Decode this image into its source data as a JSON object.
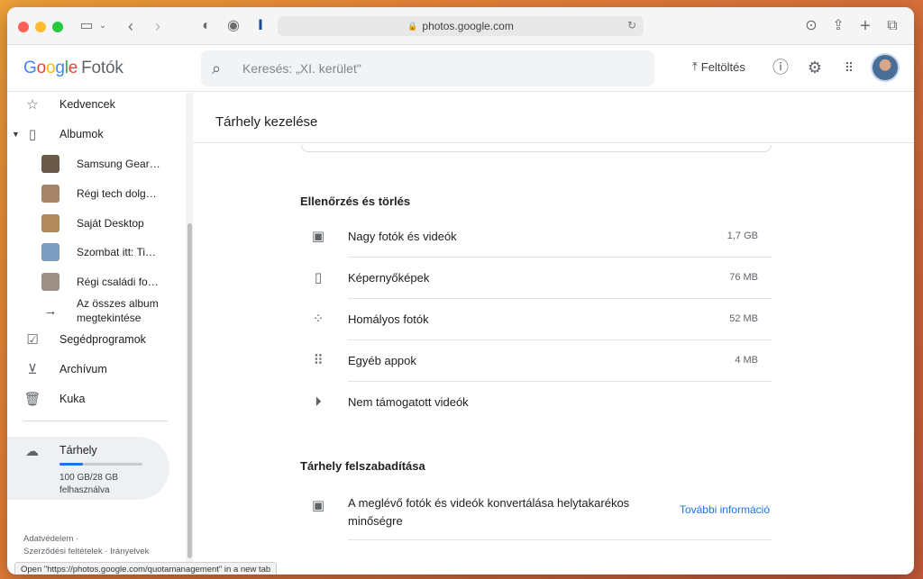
{
  "browser": {
    "url": "photos.google.com"
  },
  "header": {
    "logo_google": "Google",
    "logo_product": "Fotók",
    "search_placeholder": "Keresés: „XI. kerület\"",
    "upload_label": "Feltöltés"
  },
  "sidebar": {
    "items_top": [
      {
        "label": "Kedvencek",
        "icon": "star-icon"
      },
      {
        "label": "Albumok",
        "icon": "album-icon"
      }
    ],
    "albums": [
      {
        "label": "Samsung Gear…",
        "thumb_color": "#6b5a4a"
      },
      {
        "label": "Régi tech dolg…",
        "thumb_color": "#a58467"
      },
      {
        "label": "Saját Desktop",
        "thumb_color": "#b08a5c"
      },
      {
        "label": "Szombat itt: Ti…",
        "thumb_color": "#7b9bbf"
      },
      {
        "label": "Régi családi fo…",
        "thumb_color": "#9d8f86"
      }
    ],
    "all_albums_line1": "Az összes album",
    "all_albums_line2": "megtekintése",
    "items_bottom": [
      {
        "label": "Segédprogramok",
        "icon": "utilities-icon"
      },
      {
        "label": "Archívum",
        "icon": "archive-icon"
      },
      {
        "label": "Kuka",
        "icon": "trash-icon"
      }
    ],
    "storage": {
      "label": "Tárhely",
      "used_text": "100 GB/28 GB felhasználva",
      "fill_fraction": 0.28
    },
    "footer": {
      "privacy": "Adatvédelem",
      "terms": "Szerződési feltételek",
      "policies": "Irányelvek"
    }
  },
  "status_tooltip": "Open \"https://photos.google.com/quotamanagement\" in a new tab",
  "main": {
    "title": "Tárhely kezelése",
    "review_section": {
      "title": "Ellenőrzés és törlés",
      "rows": [
        {
          "label": "Nagy fotók és videók",
          "size": "1,7 GB",
          "icon": "large-photo-icon"
        },
        {
          "label": "Képernyőképek",
          "size": "76 MB",
          "icon": "screenshot-icon"
        },
        {
          "label": "Homályos fotók",
          "size": "52 MB",
          "icon": "blurry-icon"
        },
        {
          "label": "Egyéb appok",
          "size": "4 MB",
          "icon": "apps-grid-icon"
        },
        {
          "label": "Nem támogatott videók",
          "size": "",
          "icon": "play-circle-icon"
        }
      ]
    },
    "free_section": {
      "title": "Tárhely felszabadítása",
      "convert_label": "A meglévő fotók és videók konvertálása helytakarékos minőségre",
      "convert_link": "További információ"
    }
  }
}
